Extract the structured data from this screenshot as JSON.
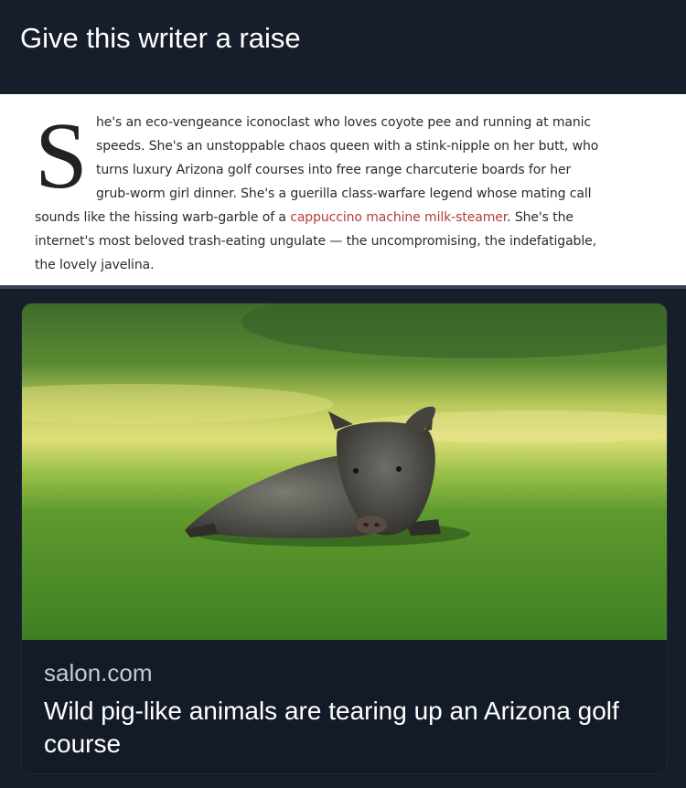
{
  "post": {
    "title": "Give this writer a raise"
  },
  "article": {
    "dropcap": "S",
    "lines": [
      "he's an eco-vengeance iconoclast who loves coyote pee and running at manic",
      "speeds. She's an unstoppable chaos queen with a stink-nipple on her butt, who",
      "turns luxury Arizona golf courses into free range charcuterie boards for her",
      "grub-worm girl dinner. She's a guerilla class-warfare legend whose mating call"
    ],
    "line5_before": "sounds like the hissing warb-garble of a ",
    "line5_link": "cappuccino machine milk-steamer",
    "line5_after": ". She's the",
    "line6": "internet's most beloved trash-eating ungulate — the uncompromising, the indefatigable,",
    "line7": "the lovely javelina.",
    "link_color": "#b63a3a"
  },
  "link_card": {
    "domain": "salon.com",
    "headline": "Wild pig-like animals are tearing up an Arizona golf course",
    "image_alt": "javelina lying on golf course grass"
  }
}
